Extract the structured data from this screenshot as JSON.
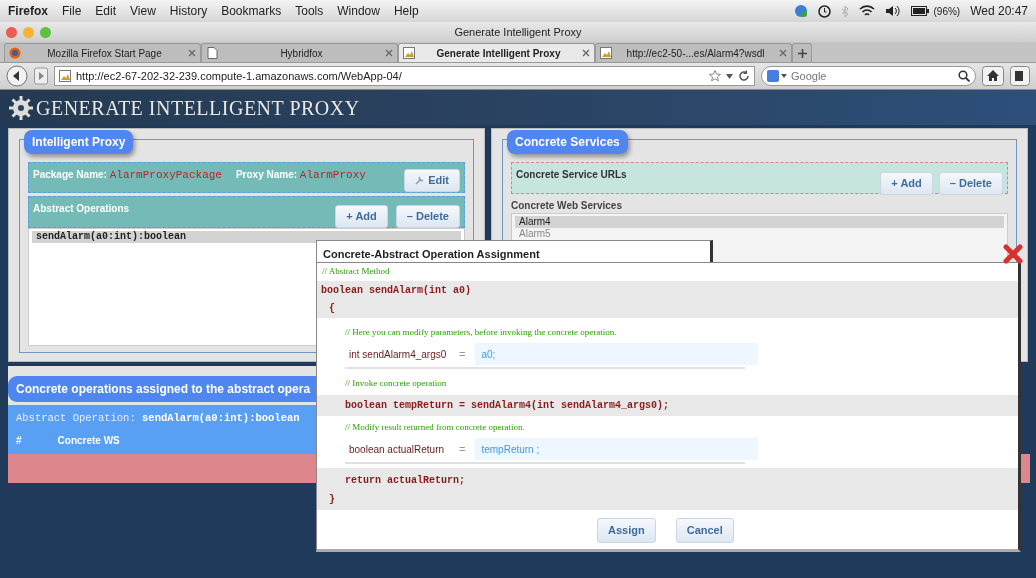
{
  "menu_bar": {
    "app": "Firefox",
    "items": [
      "File",
      "Edit",
      "View",
      "History",
      "Bookmarks",
      "Tools",
      "Window",
      "Help"
    ],
    "battery": "(96%)",
    "clock": "Wed 20:47"
  },
  "window": {
    "title": "Generate Intelligent Proxy"
  },
  "tabs": [
    {
      "label": "Mozilla Firefox Start Page",
      "selected": false,
      "kind": "firefox"
    },
    {
      "label": "Hybridfox",
      "selected": false,
      "kind": "page"
    },
    {
      "label": "Generate Intelligent Proxy",
      "selected": true,
      "kind": "picture"
    },
    {
      "label": "http://ec2-50-...es/Alarm4?wsdl",
      "selected": false,
      "kind": "picture"
    }
  ],
  "address_bar": {
    "url": "http://ec2-67-202-32-239.compute-1.amazonaws.com/WebApp-04/"
  },
  "search": {
    "placeholder": "Google"
  },
  "page": {
    "title": "GENERATE INTELLIGENT PROXY"
  },
  "proxy_panel": {
    "legend": "Intelligent Proxy",
    "package_label": "Package Name:",
    "package_name": "AlarmProxyPackage",
    "proxy_label": "Proxy Name:",
    "proxy_name": "AlarmProxy",
    "edit_button": "Edit",
    "ops_label": "Abstract Operations",
    "add_button": "+ Add",
    "delete_button": "– Delete",
    "operations": [
      {
        "label": "sendAlarm(a0:int):boolean",
        "selected": true
      }
    ]
  },
  "services_panel": {
    "legend": "Concrete Services",
    "urls_label": "Concrete Service URLs",
    "add_button": "+ Add",
    "delete_button": "– Delete",
    "list_label": "Concrete Web Services",
    "services": [
      {
        "label": "Alarm4",
        "selected": true
      },
      {
        "label": "Alarm5",
        "selected": false
      }
    ]
  },
  "assigned": {
    "heading": "Concrete operations assigned to the abstract opera",
    "op_label": "Abstract Operation:",
    "op_name": "sendAlarm(a0:int):boolean",
    "columns": [
      "#",
      "Concrete WS"
    ]
  },
  "dialog": {
    "title": "Concrete-Abstract Operation Assignment",
    "comment": "// Abstract Method",
    "signature": "boolean sendAlarm(int a0)",
    "open": "{",
    "close": "}",
    "body": [
      {
        "kind": "comment",
        "text": "// Here you can modify parameters, before invoking the concrete operation."
      },
      {
        "kind": "field",
        "label": "int sendAlarm4_args0",
        "equals": "=",
        "value": "a0;"
      },
      {
        "kind": "comment",
        "text": "// Invoke concrete operation"
      },
      {
        "kind": "statement",
        "text": "boolean tempReturn = sendAlarm4(int sendAlarm4_args0);"
      },
      {
        "kind": "comment",
        "text": "// Modify result returned from concrete operation."
      },
      {
        "kind": "field",
        "label": "boolean actualReturn",
        "equals": "=",
        "value": "tempReturn ;"
      }
    ],
    "return_statement": "return actualReturn;",
    "buttons": [
      "Assign",
      "Cancel"
    ]
  }
}
